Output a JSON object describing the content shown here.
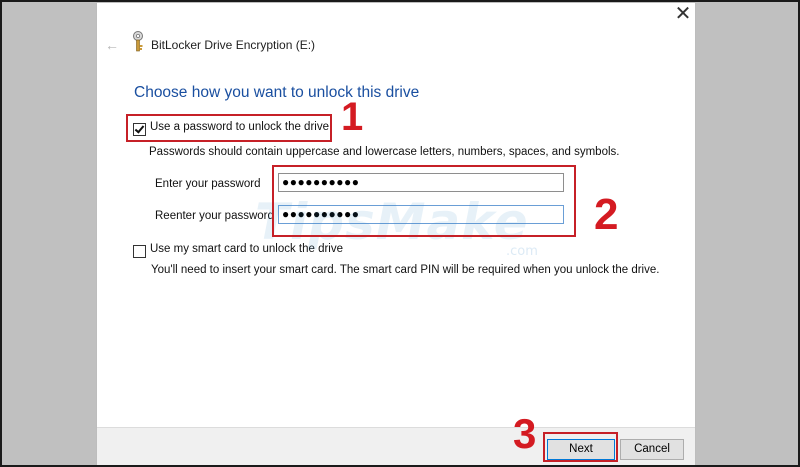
{
  "window": {
    "title": "BitLocker Drive Encryption (E:)",
    "back_icon": "back-arrow-icon",
    "close_icon": "close-icon"
  },
  "heading": "Choose how you want to unlock this drive",
  "password_option": {
    "label": "Use a password to unlock the drive",
    "checked": true,
    "description": "Passwords should contain uppercase and lowercase letters, numbers, spaces, and symbols.",
    "enter_label": "Enter your password",
    "enter_value": "●●●●●●●●●●",
    "reenter_label": "Reenter your password",
    "reenter_value": "●●●●●●●●●●"
  },
  "smartcard_option": {
    "label": "Use my smart card to unlock the drive",
    "checked": false,
    "description": "You'll need to insert your smart card. The smart card PIN will be required when you unlock the drive."
  },
  "footer": {
    "next_label": "Next",
    "cancel_label": "Cancel"
  },
  "annotations": {
    "step1": "1",
    "step2": "2",
    "step3": "3",
    "color": "#d41b22"
  },
  "watermark": {
    "text": "TipsMake",
    "suffix": ".com"
  }
}
